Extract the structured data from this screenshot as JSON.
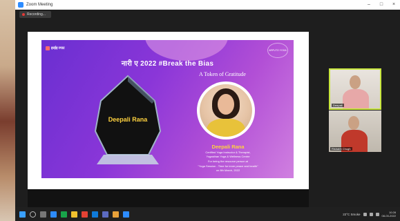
{
  "window": {
    "title": "Zoom Meeting",
    "controls": [
      "–",
      "□",
      "×"
    ]
  },
  "recording": {
    "label": "Recording..."
  },
  "slide": {
    "logo_left": "इरईइ रपाट",
    "headline": "नारी ए 2022 #Break the Bias",
    "subtitle": "A Token of Gratitude",
    "trophy_name": "Deepali Rana",
    "logo_right": "ARPUTO YOGA",
    "honoree": {
      "name": "Deepali Rana",
      "title_line": "Certified Yoga Instructor & Therapist,",
      "org_line": "Yogasthan Yoga & Wellness Centre",
      "thanks_line": "For being the resource person at",
      "session_line": "\"Yoga Session - Time for inner peace and health\"",
      "date_line": "on 8th March, 2022"
    }
  },
  "participants": [
    {
      "name": "Deepali",
      "active_speaker": true
    },
    {
      "name": "Rishabh Chugh",
      "active_speaker": false
    }
  ],
  "taskbar": {
    "icons": [
      "start-icon",
      "search-icon",
      "task-view-icon",
      "zoom-icon",
      "spotify-icon",
      "sticky-notes-icon",
      "office-icon",
      "edge-icon",
      "teams-icon",
      "files-icon",
      "zoom-taskbar-icon"
    ],
    "weather": "22°C Smoke",
    "clock_time": "10:28",
    "clock_date": "08-03-2022"
  },
  "colors": {
    "active_speaker_border": "#c8e63c",
    "slide_gradient_start": "#6a2fd1",
    "slide_gradient_end": "#d080e0",
    "accent_gold": "#ffd23f"
  }
}
